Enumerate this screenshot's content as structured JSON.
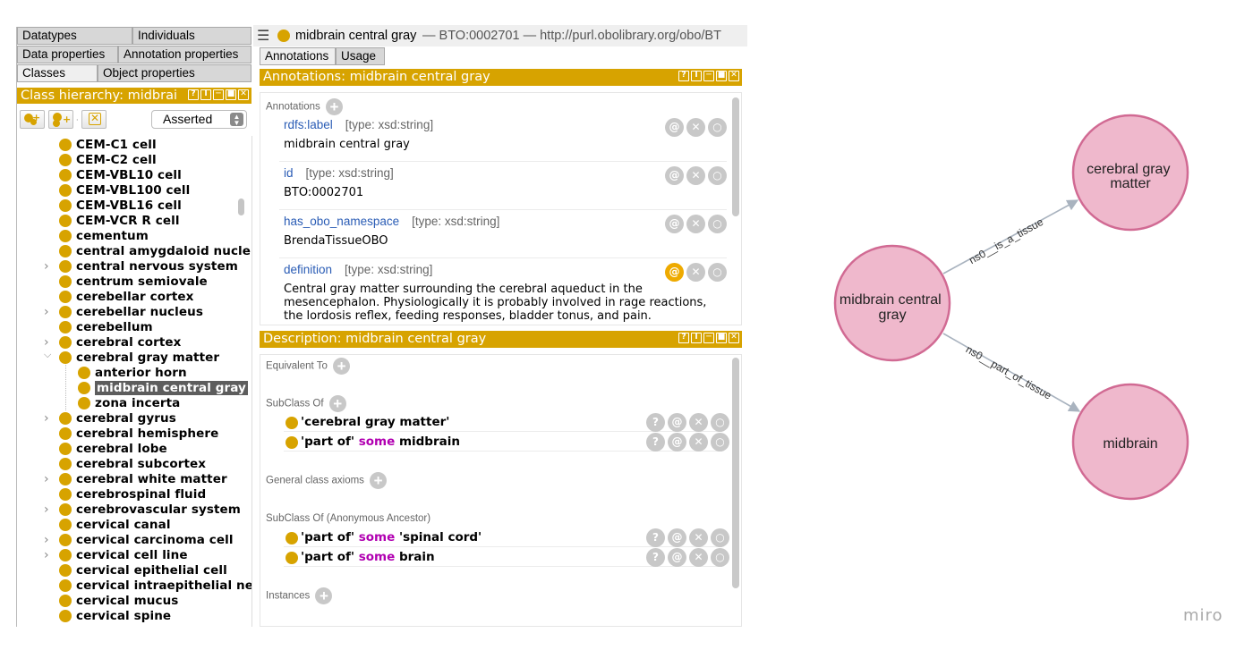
{
  "left_panel": {
    "tabs_row1": [
      "Datatypes",
      "Individuals"
    ],
    "tabs_row2": [
      "Data properties",
      "Annotation properties"
    ],
    "tabs_row3": [
      "Classes",
      "Object properties"
    ],
    "class_hierarchy_title": "Class hierarchy: midbrai",
    "window_buttons": [
      "?",
      "I",
      "─",
      "■",
      "✕"
    ],
    "reasoner_select": "Asserted",
    "tree": [
      {
        "label": "CEM-C1 cell",
        "level": 1,
        "expander": false
      },
      {
        "label": "CEM-C2 cell",
        "level": 1,
        "expander": false
      },
      {
        "label": "CEM-VBL10 cell",
        "level": 1,
        "expander": false
      },
      {
        "label": "CEM-VBL100 cell",
        "level": 1,
        "expander": false
      },
      {
        "label": "CEM-VBL16 cell",
        "level": 1,
        "expander": false
      },
      {
        "label": "CEM-VCR R cell",
        "level": 1,
        "expander": false
      },
      {
        "label": "cementum",
        "level": 1,
        "expander": false
      },
      {
        "label": "central amygdaloid nucleus",
        "level": 1,
        "expander": false
      },
      {
        "label": "central nervous system",
        "level": 1,
        "expander": true
      },
      {
        "label": "centrum semiovale",
        "level": 1,
        "expander": false
      },
      {
        "label": "cerebellar cortex",
        "level": 1,
        "expander": false
      },
      {
        "label": "cerebellar nucleus",
        "level": 1,
        "expander": true
      },
      {
        "label": "cerebellum",
        "level": 1,
        "expander": false
      },
      {
        "label": "cerebral cortex",
        "level": 1,
        "expander": true
      },
      {
        "label": "cerebral gray matter",
        "level": 1,
        "expander": "open"
      },
      {
        "label": "anterior horn",
        "level": 2,
        "expander": false
      },
      {
        "label": "midbrain central gray",
        "level": 2,
        "expander": false,
        "selected": true
      },
      {
        "label": "zona incerta",
        "level": 2,
        "expander": false
      },
      {
        "label": "cerebral gyrus",
        "level": 1,
        "expander": true
      },
      {
        "label": "cerebral hemisphere",
        "level": 1,
        "expander": false
      },
      {
        "label": "cerebral lobe",
        "level": 1,
        "expander": false
      },
      {
        "label": "cerebral subcortex",
        "level": 1,
        "expander": false
      },
      {
        "label": "cerebral white matter",
        "level": 1,
        "expander": true
      },
      {
        "label": "cerebrospinal fluid",
        "level": 1,
        "expander": false
      },
      {
        "label": "cerebrovascular system",
        "level": 1,
        "expander": true
      },
      {
        "label": "cervical canal",
        "level": 1,
        "expander": false
      },
      {
        "label": "cervical carcinoma cell",
        "level": 1,
        "expander": true
      },
      {
        "label": "cervical cell line",
        "level": 1,
        "expander": true
      },
      {
        "label": "cervical epithelial cell",
        "level": 1,
        "expander": false
      },
      {
        "label": "cervical intraepithelial neop",
        "level": 1,
        "expander": false
      },
      {
        "label": "cervical mucus",
        "level": 1,
        "expander": false
      },
      {
        "label": "cervical spine",
        "level": 1,
        "expander": false
      }
    ]
  },
  "entity": {
    "name": "midbrain central gray",
    "iri": "— BTO:0002701 — http://purl.obolibrary.org/obo/BT"
  },
  "mid_tabs": [
    "Annotations",
    "Usage"
  ],
  "annotations": {
    "title": "Annotations: midbrain central gray",
    "section_label": "Annotations",
    "rows": [
      {
        "property": "rdfs:label",
        "type": "[type: xsd:string]",
        "value": "midbrain central gray",
        "highlight": false
      },
      {
        "property": "id",
        "type": "[type: xsd:string]",
        "value": "BTO:0002701",
        "highlight": false
      },
      {
        "property": "has_obo_namespace",
        "type": "[type: xsd:string]",
        "value": "BrendaTissueOBO",
        "highlight": false
      },
      {
        "property": "definition",
        "type": "[type: xsd:string]",
        "value": "Central gray matter surrounding the cerebral aqueduct in the mesencephalon. Physiologically it is probably involved in rage reactions, the lordosis reflex, feeding responses, bladder tonus, and pain.",
        "highlight": true
      }
    ]
  },
  "description": {
    "title": "Description: midbrain central gray",
    "equivalent_to": "Equivalent To",
    "subclass_of": "SubClass Of",
    "subclass_axioms": [
      {
        "pre": "'cerebral gray matter'",
        "kw": "",
        "post": ""
      },
      {
        "pre": "'part of' ",
        "kw": "some",
        "post": " midbrain"
      }
    ],
    "general_axioms": "General class axioms",
    "anon_ancestor": "SubClass Of (Anonymous Ancestor)",
    "ancestor_axioms": [
      {
        "pre": "'part of' ",
        "kw": "some",
        "post": " 'spinal cord'"
      },
      {
        "pre": "'part of' ",
        "kw": "some",
        "post": " brain"
      }
    ],
    "instances": "Instances"
  },
  "graph": {
    "nodes": {
      "source": "midbrain central gray",
      "target1": "cerebral gray matter",
      "target2": "midbrain"
    },
    "edges": {
      "e1": "ns0__is_a_tissue",
      "e2": "ns0__part_of_tissue"
    },
    "node_fill": "#efb8cc",
    "node_stroke": "#d16a93"
  },
  "watermark": "miro",
  "colors": {
    "accent": "#d7a300",
    "keyword": "#b100b1",
    "property": "#2a5cb5"
  }
}
